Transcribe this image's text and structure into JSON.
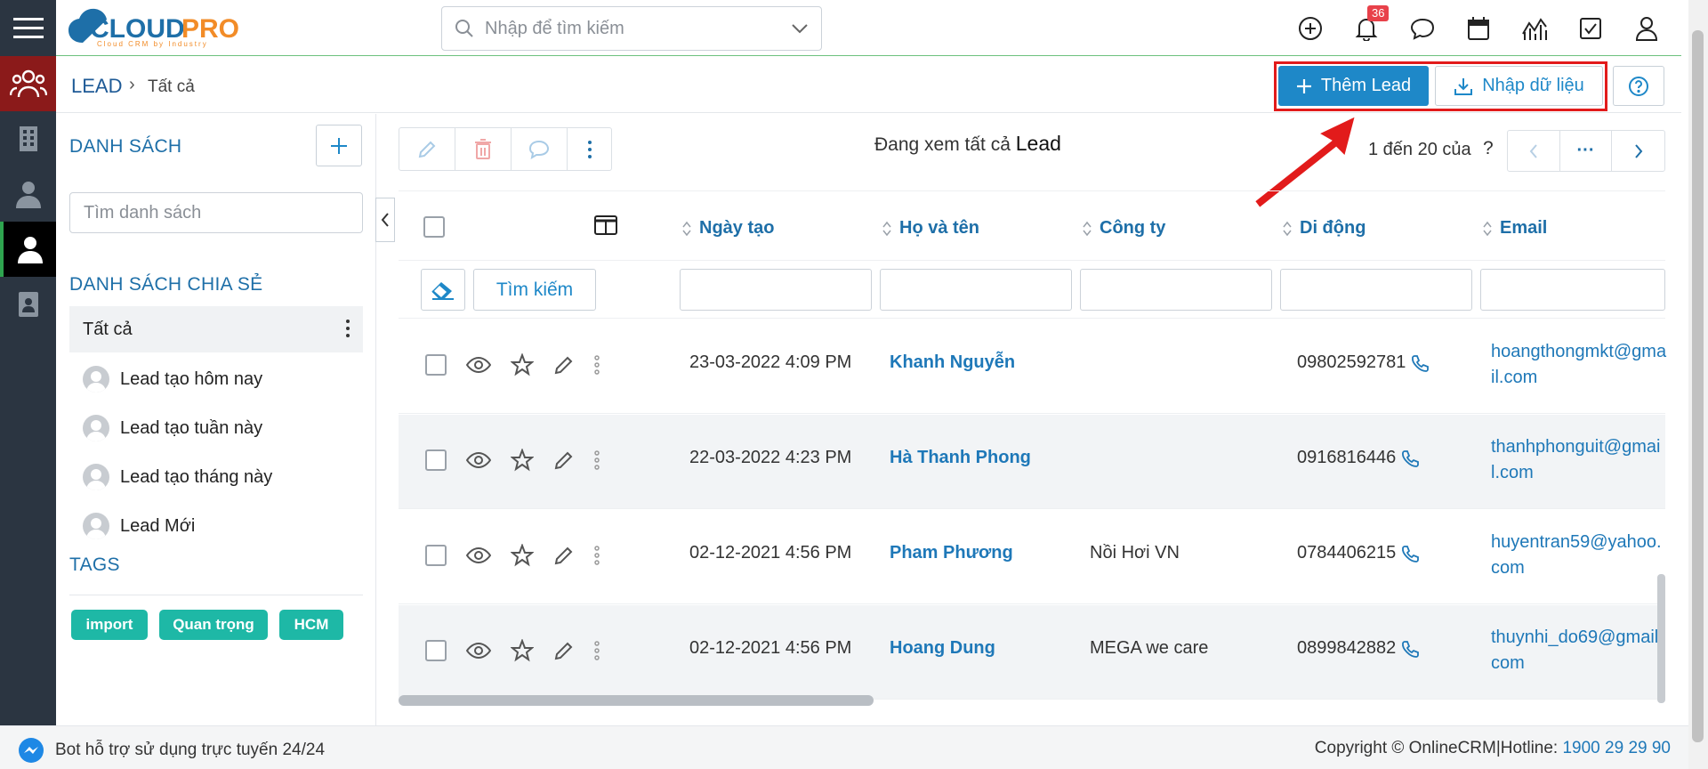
{
  "app": {
    "brand": "CLOUDPRO",
    "tagline": "Cloud CRM by Industry",
    "brand_color": "#1e6fa8",
    "accent_color": "#1e88c8"
  },
  "header": {
    "search_placeholder": "Nhập để tìm kiếm",
    "notification_count": "36",
    "icons": [
      "plus-circle-icon",
      "bell-icon",
      "chat-icon",
      "calendar-icon",
      "chart-icon",
      "checkbox-icon",
      "user-icon"
    ]
  },
  "breadcrumb": {
    "module": "LEAD",
    "separator": "›",
    "current": "Tất cả"
  },
  "actions": {
    "add_label": "Thêm Lead",
    "import_label": "Nhập dữ liệu"
  },
  "sidebar": {
    "list_heading": "DANH SÁCH",
    "search_placeholder": "Tìm danh sách",
    "shared_heading": "DANH SÁCH CHIA SẺ",
    "all_label": "Tất cả",
    "items": [
      {
        "label": "Lead tạo hôm nay"
      },
      {
        "label": "Lead tạo tuần này"
      },
      {
        "label": "Lead tạo tháng này"
      },
      {
        "label": "Lead Mới"
      }
    ],
    "tags_heading": "TAGS",
    "tags": [
      "import",
      "Quan trọng",
      "HCM"
    ]
  },
  "main": {
    "viewing_prefix": "Đang xem tất cả",
    "viewing_module": "Lead",
    "pager_text": "1 đến 20 của",
    "pager_unknown": "?",
    "pager_more": "···",
    "columns": {
      "created": "Ngày tạo",
      "name": "Họ và tên",
      "company": "Công ty",
      "mobile": "Di động",
      "email": "Email"
    },
    "search_button": "Tìm kiếm",
    "rows": [
      {
        "created": "23-03-2022 4:09 PM",
        "name": "Khanh Nguyễn",
        "company": "",
        "mobile": "09802592781",
        "email": "hoangthongmkt@gmail.com"
      },
      {
        "created": "22-03-2022 4:23 PM",
        "name": "Hà Thanh Phong",
        "company": "",
        "mobile": "0916816446",
        "email": "thanhphonguit@gmail.com"
      },
      {
        "created": "02-12-2021 4:56 PM",
        "name": "Pham Phương",
        "company": "Nồi Hơi VN",
        "mobile": "0784406215",
        "email": "huyentran59@yahoo.com"
      },
      {
        "created": "02-12-2021 4:56 PM",
        "name": "Hoang Dung",
        "company": "MEGA we care",
        "mobile": "0899842882",
        "email": "thuynhi_do69@gmail.com"
      }
    ]
  },
  "footer": {
    "bot_text": "Bot hỗ trợ sử dụng trực tuyến 24/24",
    "copyright": "Copyright © OnlineCRM|Hotline:",
    "hotline": "1900 29 29 90"
  }
}
